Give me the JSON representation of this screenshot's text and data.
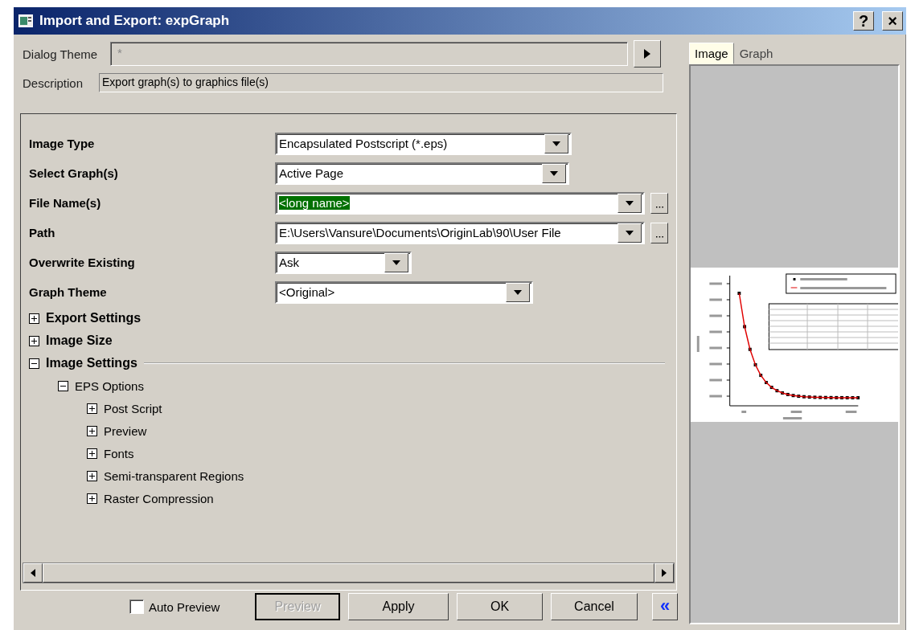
{
  "window": {
    "title": "Import and Export: expGraph",
    "buttons": [
      "?",
      "×"
    ]
  },
  "dialog_theme": {
    "label": "Dialog Theme",
    "value": "*"
  },
  "description": {
    "label": "Description",
    "value": "Export graph(s) to graphics file(s)"
  },
  "settings": [
    {
      "label": "Image Type",
      "value": "Encapsulated Postscript (*.eps)",
      "selected": false,
      "browse": false
    },
    {
      "label": "Select Graph(s)",
      "value": "Active Page",
      "selected": false,
      "browse": false
    },
    {
      "label": "File Name(s)",
      "value": "<long name>",
      "selected": true,
      "browse": true
    },
    {
      "label": "Path",
      "value": "E:\\Users\\Vansure\\Documents\\OriginLab\\90\\User File",
      "selected": false,
      "browse": true
    },
    {
      "label": "Overwrite Existing",
      "value": "Ask",
      "selected": false,
      "browse": false
    },
    {
      "label": "Graph Theme",
      "value": "<Original>",
      "selected": false,
      "browse": false
    }
  ],
  "tree": [
    {
      "label": "Export Settings",
      "expanded": false
    },
    {
      "label": "Image Size",
      "expanded": false
    },
    {
      "label": "Image Settings",
      "expanded": true,
      "children": [
        {
          "label": "EPS Options",
          "expanded": true,
          "children": [
            {
              "label": "Post Script",
              "expanded": false
            },
            {
              "label": "Preview",
              "expanded": false
            },
            {
              "label": "Fonts",
              "expanded": false
            },
            {
              "label": "Semi-transparent Regions",
              "expanded": false
            },
            {
              "label": "Raster Compression",
              "expanded": false
            }
          ]
        }
      ]
    }
  ],
  "auto_preview": {
    "label": "Auto Preview",
    "checked": false
  },
  "buttons": [
    {
      "label": "Preview",
      "disabled": true
    },
    {
      "label": "Apply",
      "disabled": false
    },
    {
      "label": "OK",
      "disabled": false
    },
    {
      "label": "Cancel",
      "disabled": false
    }
  ],
  "collapse_button": "«",
  "preview_tabs": [
    {
      "label": "Image",
      "selected": true
    },
    {
      "label": "Graph",
      "selected": false
    }
  ]
}
